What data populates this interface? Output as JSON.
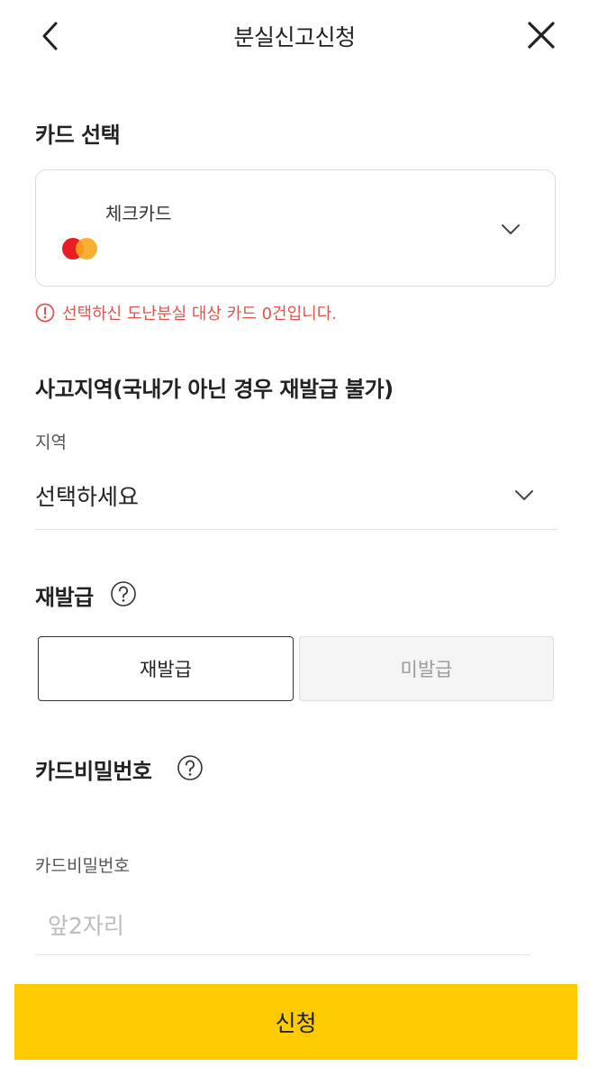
{
  "header": {
    "title": "분실신고신청"
  },
  "card_section": {
    "heading": "카드 선택",
    "selected_card": "체크카드",
    "warning": "선택하신 도난분실 대상 카드 0건입니다."
  },
  "region_section": {
    "heading": "사고지역(국내가 아닌 경우 재발급 불가)",
    "field_label": "지역",
    "selected_value": "선택하세요"
  },
  "reissue_section": {
    "heading": "재발급",
    "options": [
      "재발급",
      "미발급"
    ],
    "selected": "재발급"
  },
  "password_section": {
    "heading": "카드비밀번호",
    "field_label": "카드비밀번호",
    "placeholder": "앞2자리"
  },
  "submit_label": "신청",
  "colors": {
    "accent": "#fecb00",
    "warning": "#e0564e"
  },
  "icons": [
    "back-arrow-icon",
    "close-icon",
    "card-brand-logo",
    "chevron-down-icon",
    "alert-icon",
    "help-icon"
  ]
}
